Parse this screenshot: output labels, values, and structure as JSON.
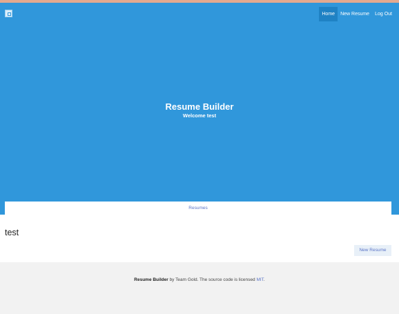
{
  "nav": {
    "home": "Home",
    "new_resume": "New Resume",
    "logout": "Log Out"
  },
  "hero": {
    "title": "Resume Builder",
    "subtitle": "Welcome test"
  },
  "tabs": {
    "resumes": "Resumes"
  },
  "content": {
    "heading": "test",
    "new_resume_button": "New Resume"
  },
  "footer": {
    "brand": "Resume Builder",
    "text_before_link": " by Team Gold. The source code is licensed ",
    "link": "MIT",
    "text_after_link": "."
  },
  "colors": {
    "hero_bg": "#3097db",
    "active_nav": "#1f82c4",
    "link": "#5b74c7"
  }
}
